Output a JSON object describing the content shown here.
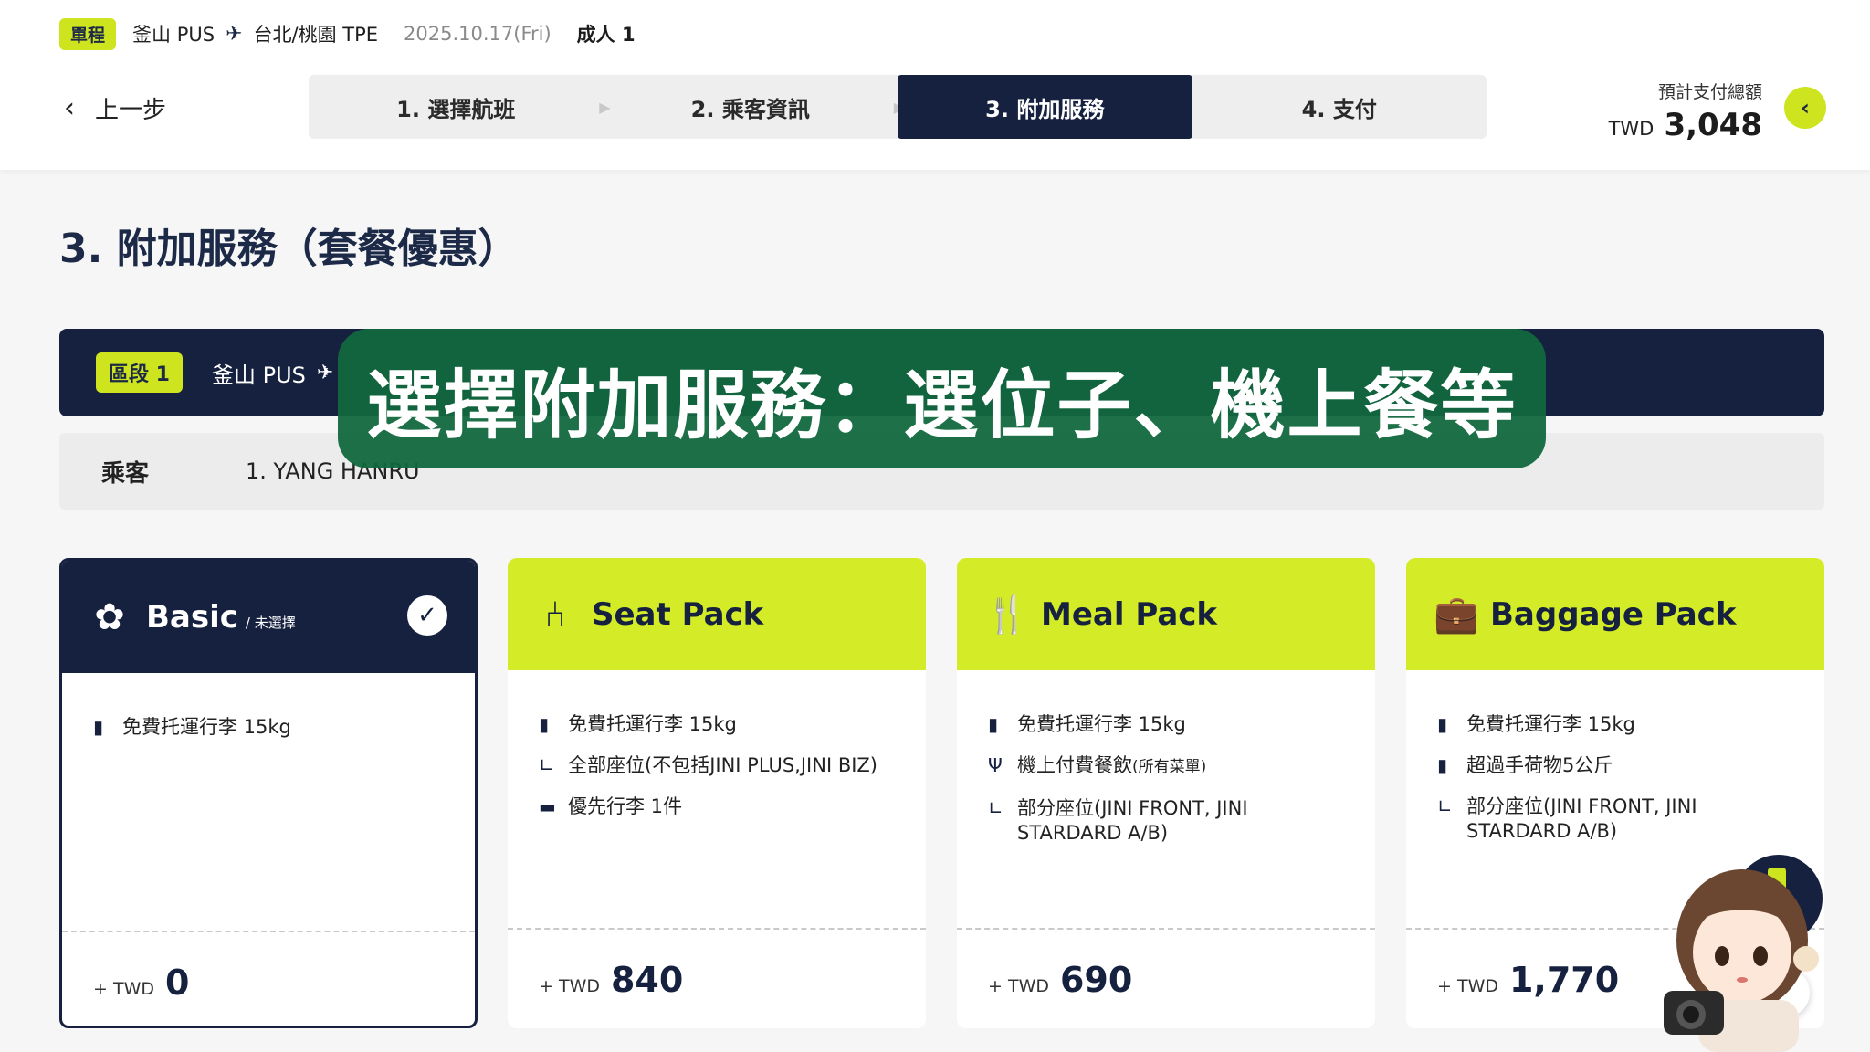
{
  "trip": {
    "type": "單程",
    "from": "釜山 PUS",
    "to": "台北/桃園 TPE",
    "date": "2025.10.17(Fri)",
    "passengers": "成人 1"
  },
  "nav": {
    "back_label": "上一步"
  },
  "steps": [
    {
      "label": "1. 選擇航班"
    },
    {
      "label": "2. 乘客資訊"
    },
    {
      "label": "3. 附加服務"
    },
    {
      "label": "4. 支付"
    }
  ],
  "total": {
    "label": "預計支付總額",
    "currency": "TWD",
    "amount": "3,048"
  },
  "page_title": "3. 附加服務（套餐優惠）",
  "segment": {
    "badge": "區段 1",
    "from": "釜山 PUS"
  },
  "passenger": {
    "label": "乘客",
    "name": "1. YANG HANRU"
  },
  "overlay_caption": "選擇附加服務：選位子、機上餐等",
  "cards": [
    {
      "title": "Basic",
      "subtitle": "/ 未選擇",
      "features": [
        {
          "icon": "luggage-icon",
          "text": "免費托運行李 15kg"
        }
      ],
      "price_prefix": "+ TWD",
      "price": "0"
    },
    {
      "title": "Seat Pack",
      "features": [
        {
          "icon": "luggage-icon",
          "text": "免費托運行李 15kg"
        },
        {
          "icon": "seat-icon",
          "text": "全部座位(不包括JINI PLUS,JINI BIZ)"
        },
        {
          "icon": "priority-bag-icon",
          "text": "優先行李 1件"
        }
      ],
      "price_prefix": "+ TWD",
      "price": "840"
    },
    {
      "title": "Meal Pack",
      "features": [
        {
          "icon": "luggage-icon",
          "text": "免費托運行李 15kg"
        },
        {
          "icon": "utensils-icon",
          "text": "機上付費餐飲",
          "small": "(所有菜單)"
        },
        {
          "icon": "seat-icon",
          "text": "部分座位(JINI FRONT, JINI STARDARD A/B)"
        }
      ],
      "price_prefix": "+ TWD",
      "price": "690"
    },
    {
      "title": "Baggage Pack",
      "features": [
        {
          "icon": "luggage-icon",
          "text": "免費托運行李 15kg"
        },
        {
          "icon": "luggage-icon",
          "text": "超過手荷物5公斤"
        },
        {
          "icon": "seat-icon",
          "text": "部分座位(JINI FRONT, JINI STARDARD A/B)"
        }
      ],
      "price_prefix": "+ TWD",
      "price": "1,770"
    }
  ],
  "colors": {
    "navy": "#16213f",
    "lime": "#d4ec28",
    "overlay_green": "#12683e"
  }
}
